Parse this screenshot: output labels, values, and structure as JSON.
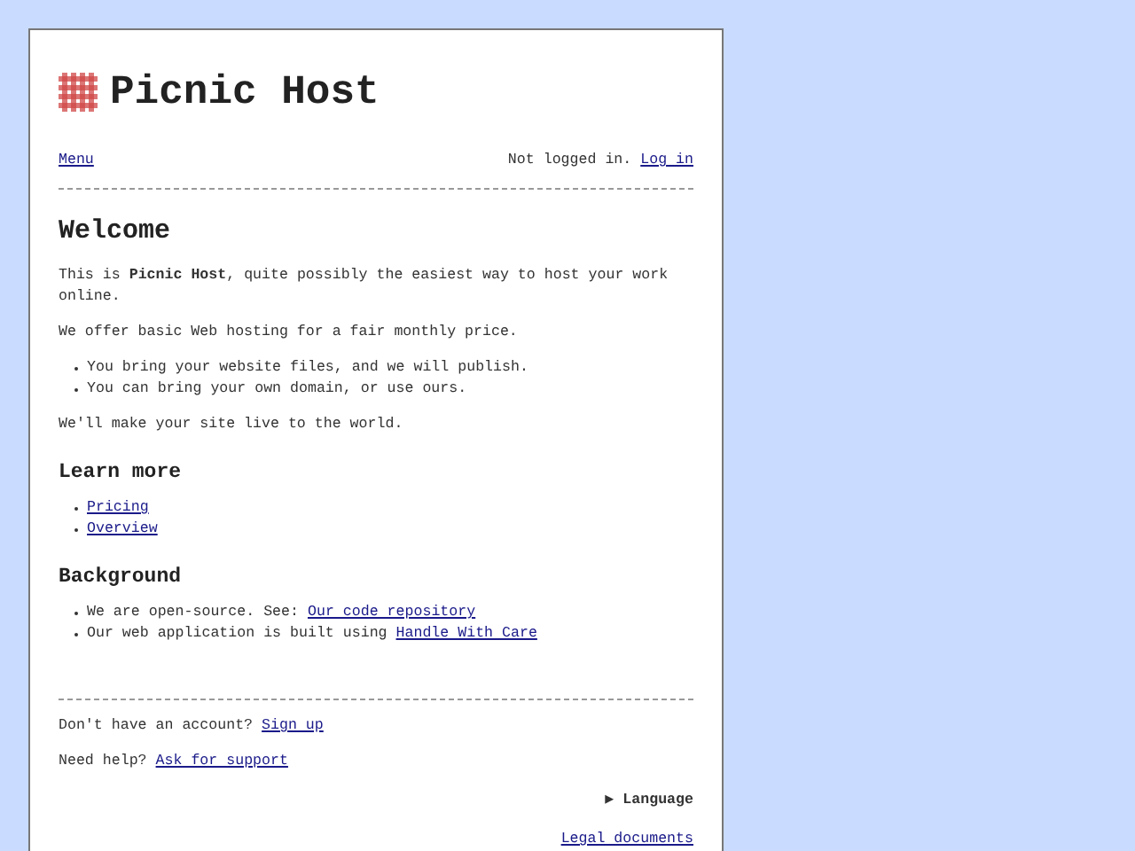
{
  "site": {
    "title": "Picnic Host"
  },
  "nav": {
    "menu": "Menu",
    "status": "Not logged in.",
    "login": "Log in"
  },
  "welcome": {
    "heading": "Welcome",
    "paragraphs": [
      "This is **Picnic Host**, quite possibly the easiest way to host your work online.",
      "We offer basic Web hosting for a fair monthly price."
    ],
    "bullets": [
      "You bring your website files, and we will publish.",
      "You can bring your own domain, or use ours."
    ],
    "closing": "We'll make your site live to the world."
  },
  "learn_more": {
    "heading": "Learn more",
    "links": [
      "Pricing",
      "Overview"
    ]
  },
  "background": {
    "heading": "Background",
    "items": [
      {
        "text": "We are open-source. See:",
        "link": "Our code repository"
      },
      {
        "text": "Our web application is built using",
        "link": "Handle With Care"
      }
    ]
  },
  "footer": {
    "lines": [
      {
        "text": "Don't have an account?",
        "link": "Sign up"
      },
      {
        "text": "Need help?",
        "link": "Ask for support"
      }
    ],
    "language": {
      "icon": "▶",
      "label": "Language",
      "expanded": false
    },
    "legal": "Legal documents"
  }
}
